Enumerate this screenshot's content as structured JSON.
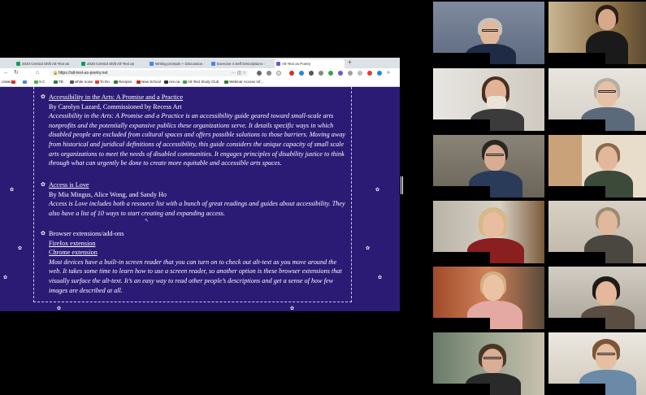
{
  "browser": {
    "tabs": [
      {
        "label": "2020 Central Shift Alt-Text an",
        "active": false
      },
      {
        "label": "2020 Central Shift Alt-Text an",
        "active": false
      },
      {
        "label": "Writing prompts + Discussion -",
        "active": false
      },
      {
        "label": "Exercise 4 Self Descriptions -",
        "active": false
      },
      {
        "label": "Alt-Text as Poetry",
        "active": true
      }
    ],
    "new_tab": "+",
    "url": "https://alt-text-as-poetry.net",
    "bookmarks": [
      {
        "label": "orated",
        "color": "#888888"
      },
      {
        "label": "",
        "color": "#d93025"
      },
      {
        "label": "",
        "color": "#4285f4"
      },
      {
        "label": "S.C",
        "color": "#4caf50"
      },
      {
        "label": "TB",
        "color": "#2e7d32"
      },
      {
        "label": "white noise",
        "color": "#555555"
      },
      {
        "label": "To Do",
        "color": "#e53935"
      },
      {
        "label": "Recipes",
        "color": "#2e7d32"
      },
      {
        "label": "New School",
        "color": "#c62828"
      },
      {
        "label": "Are.na",
        "color": "#333333"
      },
      {
        "label": "Alt-Text Study Club",
        "color": "#43a047"
      },
      {
        "label": "Webinar Access Inf...",
        "color": "#2e7d32"
      }
    ]
  },
  "entries": [
    {
      "title": "Accessibility in the Arts: A Promise and a Practice",
      "byline": "By Carolyn Lazard, Commissioned by Recess Art",
      "description": "Accessibility in the Arts: A Promise and a Practice is an accessibility guide geared toward small-scale arts nonprofits and the potentially expansive publics these organizations serve. It details specific ways in which disabled people are excluded from cultural spaces and offers possible solutions to those barriers. Moving away from historical and juridical definitions of accessibility, this guide considers the unique capacity of small scale arts organizations to meet the needs of disabled communities. It engages principles of disability justice to think through what can urgently be done to create more equitable and accessible arts spaces."
    },
    {
      "title": "Access is Love",
      "byline": "By Mia Mingus, Alice Wong, and Sandy Ho",
      "description": "Access is Love includes both a resource list with a bunch of great readings and guides about accessibility. They also have a list of 10 ways to start creating and expanding access."
    },
    {
      "heading": "Browser extensions/add-ons",
      "links": [
        "Firefox extension",
        "Chrome extension"
      ],
      "description": "Most devices have a built-in screen reader that you can turn on to check out alt-text as you move around the web. It takes some time to learn how to use a screen reader, so another option is these browser extensions that visually surface the alt-text. It’s an easy way to read other people’s descriptions and get a sense of how few images are described at all."
    }
  ],
  "bullet_glyph": "✿",
  "participants": [
    {
      "name": "",
      "speaking": true
    },
    {
      "name": "",
      "speaking": false
    },
    {
      "name": "",
      "speaking": false
    },
    {
      "name": "",
      "speaking": false
    },
    {
      "name": "",
      "speaking": false
    },
    {
      "name": "",
      "speaking": false
    },
    {
      "name": "",
      "speaking": false
    },
    {
      "name": "",
      "speaking": false
    },
    {
      "name": "",
      "speaking": false
    },
    {
      "name": "",
      "speaking": false
    },
    {
      "name": "",
      "speaking": false
    },
    {
      "name": "",
      "speaking": false
    }
  ],
  "colors": {
    "page_background": "#2b1b75",
    "speaker_highlight": "#d6e94a"
  }
}
